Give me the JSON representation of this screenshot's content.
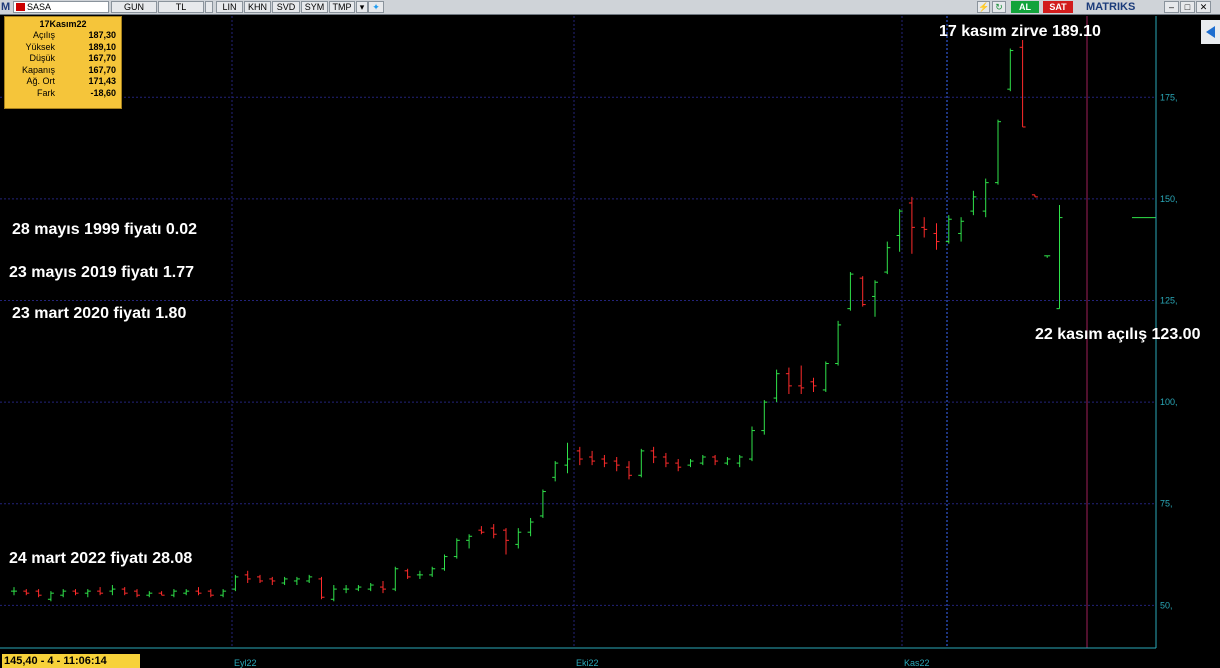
{
  "toolbar": {
    "symbol": "SASA",
    "buttons": [
      "GUN",
      "TL",
      "LIN",
      "KHN",
      "SVD",
      "SYM",
      "TMP"
    ],
    "buy": "AL",
    "sell": "SAT",
    "brand": "MATRIKS"
  },
  "info_box": {
    "title": "17Kasım22",
    "rows": [
      {
        "label": "Açılış",
        "value": "187,30"
      },
      {
        "label": "Yüksek",
        "value": "189,10"
      },
      {
        "label": "Düşük",
        "value": "167,70"
      },
      {
        "label": "Kapanış",
        "value": "167,70"
      },
      {
        "label": "Ağ. Ort",
        "value": "171,43"
      },
      {
        "label": "Fark",
        "value": "-18,60"
      }
    ]
  },
  "annotations": {
    "a1": "17 kasım zirve 189.10",
    "a2": "28 mayıs 1999 fiyatı 0.02",
    "a3": "23 mayıs 2019 fiyatı 1.77",
    "a4": "23 mart 2020 fiyatı 1.80",
    "a5": "22 kasım açılış 123.00",
    "a6": "24 mart  2022 fiyatı 28.08"
  },
  "status": "145,40 - 4 - 11:06:14",
  "x_ticks": [
    "Eyl22",
    "Eki22",
    "Kas22"
  ],
  "colors": {
    "up": "#2fe24a",
    "down": "#ff2b2b",
    "axis": "#2aa8b8",
    "grid": "#23237a"
  },
  "chart_data": {
    "type": "ohlc",
    "yticks": [
      50,
      75,
      100,
      125,
      150,
      175
    ],
    "ytick_labels": [
      "50,",
      "75,",
      "100,",
      "125,",
      "150,",
      "175,"
    ],
    "ylim": [
      40,
      195
    ],
    "bars": [
      {
        "o": 53.5,
        "h": 54.5,
        "l": 52.5,
        "c": 53.5
      },
      {
        "o": 53.5,
        "h": 54.0,
        "l": 52.5,
        "c": 53.0
      },
      {
        "o": 53.5,
        "h": 54.0,
        "l": 52.0,
        "c": 52.5
      },
      {
        "o": 51.5,
        "h": 53.5,
        "l": 51.0,
        "c": 53.0
      },
      {
        "o": 52.5,
        "h": 54.0,
        "l": 52.0,
        "c": 53.5
      },
      {
        "o": 53.5,
        "h": 54.0,
        "l": 52.5,
        "c": 53.0
      },
      {
        "o": 53.0,
        "h": 54.0,
        "l": 52.0,
        "c": 53.5
      },
      {
        "o": 53.5,
        "h": 54.5,
        "l": 52.5,
        "c": 53.0
      },
      {
        "o": 53.5,
        "h": 55.0,
        "l": 52.5,
        "c": 54.0
      },
      {
        "o": 54.0,
        "h": 54.5,
        "l": 52.5,
        "c": 53.0
      },
      {
        "o": 53.5,
        "h": 54.0,
        "l": 52.0,
        "c": 52.5
      },
      {
        "o": 52.5,
        "h": 53.5,
        "l": 52.0,
        "c": 53.0
      },
      {
        "o": 53.0,
        "h": 53.5,
        "l": 52.5,
        "c": 52.5
      },
      {
        "o": 52.5,
        "h": 54.0,
        "l": 52.0,
        "c": 53.5
      },
      {
        "o": 53.0,
        "h": 54.0,
        "l": 52.5,
        "c": 53.5
      },
      {
        "o": 53.5,
        "h": 54.5,
        "l": 52.5,
        "c": 53.0
      },
      {
        "o": 53.5,
        "h": 54.0,
        "l": 52.0,
        "c": 52.5
      },
      {
        "o": 52.5,
        "h": 54.0,
        "l": 52.0,
        "c": 53.5
      },
      {
        "o": 54.0,
        "h": 57.5,
        "l": 53.5,
        "c": 57.0
      },
      {
        "o": 57.5,
        "h": 58.5,
        "l": 55.5,
        "c": 56.5
      },
      {
        "o": 57.0,
        "h": 57.5,
        "l": 55.5,
        "c": 56.0
      },
      {
        "o": 56.5,
        "h": 57.0,
        "l": 55.0,
        "c": 56.0
      },
      {
        "o": 55.5,
        "h": 57.0,
        "l": 55.0,
        "c": 56.5
      },
      {
        "o": 56.0,
        "h": 57.0,
        "l": 55.0,
        "c": 56.5
      },
      {
        "o": 56.0,
        "h": 57.5,
        "l": 55.5,
        "c": 57.0
      },
      {
        "o": 56.5,
        "h": 57.0,
        "l": 51.5,
        "c": 52.0
      },
      {
        "o": 51.5,
        "h": 55.0,
        "l": 51.0,
        "c": 54.0
      },
      {
        "o": 54.0,
        "h": 55.0,
        "l": 53.0,
        "c": 54.0
      },
      {
        "o": 54.0,
        "h": 55.0,
        "l": 53.5,
        "c": 54.5
      },
      {
        "o": 54.0,
        "h": 55.5,
        "l": 53.5,
        "c": 55.0
      },
      {
        "o": 54.5,
        "h": 56.0,
        "l": 53.0,
        "c": 54.0
      },
      {
        "o": 54.0,
        "h": 59.5,
        "l": 53.5,
        "c": 59.0
      },
      {
        "o": 58.5,
        "h": 59.0,
        "l": 56.5,
        "c": 57.0
      },
      {
        "o": 57.5,
        "h": 58.5,
        "l": 56.5,
        "c": 57.5
      },
      {
        "o": 57.5,
        "h": 59.5,
        "l": 57.0,
        "c": 59.0
      },
      {
        "o": 59.0,
        "h": 62.5,
        "l": 58.5,
        "c": 62.0
      },
      {
        "o": 62.0,
        "h": 66.5,
        "l": 61.5,
        "c": 66.0
      },
      {
        "o": 66.0,
        "h": 67.5,
        "l": 64.0,
        "c": 67.0
      },
      {
        "o": 68.5,
        "h": 69.5,
        "l": 67.5,
        "c": 68.0
      },
      {
        "o": 69.0,
        "h": 70.0,
        "l": 66.5,
        "c": 67.5
      },
      {
        "o": 68.5,
        "h": 69.0,
        "l": 62.5,
        "c": 66.0
      },
      {
        "o": 65.0,
        "h": 69.0,
        "l": 64.0,
        "c": 68.0
      },
      {
        "o": 68.0,
        "h": 71.5,
        "l": 67.0,
        "c": 70.5
      },
      {
        "o": 72.0,
        "h": 78.5,
        "l": 71.5,
        "c": 78.0
      },
      {
        "o": 81.5,
        "h": 85.5,
        "l": 80.5,
        "c": 85.0
      },
      {
        "o": 84.5,
        "h": 90.0,
        "l": 82.5,
        "c": 86.0
      },
      {
        "o": 88.0,
        "h": 89.0,
        "l": 84.5,
        "c": 86.0
      },
      {
        "o": 86.5,
        "h": 88.0,
        "l": 84.5,
        "c": 85.5
      },
      {
        "o": 86.0,
        "h": 87.0,
        "l": 84.0,
        "c": 85.0
      },
      {
        "o": 85.5,
        "h": 86.5,
        "l": 83.0,
        "c": 84.5
      },
      {
        "o": 84.0,
        "h": 85.5,
        "l": 81.0,
        "c": 82.0
      },
      {
        "o": 82.0,
        "h": 88.5,
        "l": 81.5,
        "c": 88.0
      },
      {
        "o": 88.0,
        "h": 89.0,
        "l": 85.0,
        "c": 86.5
      },
      {
        "o": 86.5,
        "h": 87.5,
        "l": 84.0,
        "c": 85.0
      },
      {
        "o": 85.0,
        "h": 86.0,
        "l": 83.0,
        "c": 84.0
      },
      {
        "o": 84.5,
        "h": 86.0,
        "l": 84.0,
        "c": 85.5
      },
      {
        "o": 85.0,
        "h": 87.0,
        "l": 84.5,
        "c": 86.5
      },
      {
        "o": 86.5,
        "h": 87.0,
        "l": 84.5,
        "c": 85.5
      },
      {
        "o": 85.0,
        "h": 86.5,
        "l": 84.5,
        "c": 86.0
      },
      {
        "o": 85.0,
        "h": 87.0,
        "l": 84.0,
        "c": 86.5
      },
      {
        "o": 86.0,
        "h": 94.0,
        "l": 85.5,
        "c": 93.0
      },
      {
        "o": 93.0,
        "h": 100.5,
        "l": 92.0,
        "c": 100.0
      },
      {
        "o": 101.0,
        "h": 108.0,
        "l": 100.0,
        "c": 107.0
      },
      {
        "o": 107.0,
        "h": 108.5,
        "l": 102.0,
        "c": 104.0
      },
      {
        "o": 104.0,
        "h": 109.0,
        "l": 102.0,
        "c": 103.5
      },
      {
        "o": 105.0,
        "h": 106.0,
        "l": 102.5,
        "c": 104.0
      },
      {
        "o": 103.0,
        "h": 110.0,
        "l": 102.5,
        "c": 109.5
      },
      {
        "o": 109.5,
        "h": 120.0,
        "l": 109.0,
        "c": 119.0
      },
      {
        "o": 123.0,
        "h": 132.0,
        "l": 122.5,
        "c": 131.5
      },
      {
        "o": 130.5,
        "h": 131.0,
        "l": 123.5,
        "c": 124.0
      },
      {
        "o": 126.0,
        "h": 130.0,
        "l": 121.0,
        "c": 129.5
      },
      {
        "o": 132.0,
        "h": 139.5,
        "l": 131.5,
        "c": 138.0
      },
      {
        "o": 141.0,
        "h": 147.5,
        "l": 137.0,
        "c": 147.0
      },
      {
        "o": 149.0,
        "h": 150.5,
        "l": 136.5,
        "c": 143.0
      },
      {
        "o": 143.0,
        "h": 145.5,
        "l": 140.5,
        "c": 142.5
      },
      {
        "o": 141.5,
        "h": 144.0,
        "l": 137.5,
        "c": 139.5
      },
      {
        "o": 139.5,
        "h": 146.0,
        "l": 139.0,
        "c": 145.0
      },
      {
        "o": 141.5,
        "h": 145.5,
        "l": 139.5,
        "c": 144.5
      },
      {
        "o": 147.0,
        "h": 152.0,
        "l": 146.0,
        "c": 150.5
      },
      {
        "o": 147.0,
        "h": 155.0,
        "l": 145.5,
        "c": 154.0
      },
      {
        "o": 154.0,
        "h": 169.5,
        "l": 153.5,
        "c": 169.0
      },
      {
        "o": 177.0,
        "h": 187.0,
        "l": 176.5,
        "c": 186.5
      },
      {
        "o": 187.3,
        "h": 189.1,
        "l": 167.7,
        "c": 167.7
      },
      {
        "o": 151.0,
        "h": 151.0,
        "l": 150.5,
        "c": 150.5
      },
      {
        "o": 136.0,
        "h": 136.0,
        "l": 135.5,
        "c": 136.0
      },
      {
        "o": 123.0,
        "h": 148.5,
        "l": 123.0,
        "c": 145.4
      }
    ]
  }
}
